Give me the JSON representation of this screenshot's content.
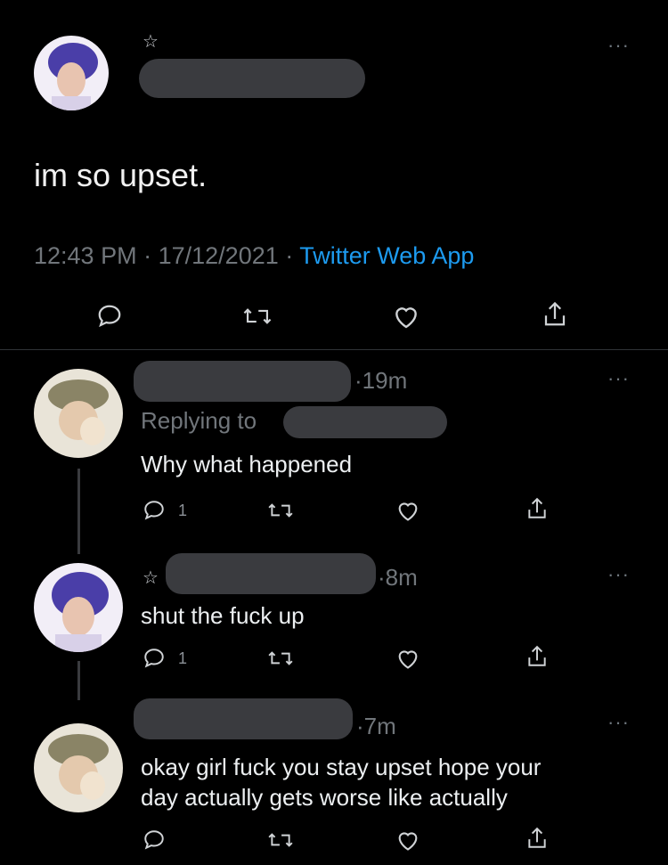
{
  "main_tweet": {
    "text": "im so upset.",
    "time": "12:43 PM",
    "date": "17/12/2021",
    "source": "Twitter Web App",
    "sep1": "·",
    "sep2": "·"
  },
  "replies": [
    {
      "time": "19m",
      "replying_label": "Replying to",
      "text": "Why what happened",
      "reply_count": "1"
    },
    {
      "time": "8m",
      "text": "shut the fuck up",
      "reply_count": "1"
    },
    {
      "time": "7m",
      "text_line1": "okay girl fuck you stay upset hope your",
      "text_line2": "day actually gets worse like actually"
    }
  ],
  "more_glyph": "···",
  "star_glyph": "☆",
  "dot_glyph": "·",
  "colors": {
    "link": "#1d9bf0",
    "bg": "#000000",
    "muted": "#71767b"
  }
}
